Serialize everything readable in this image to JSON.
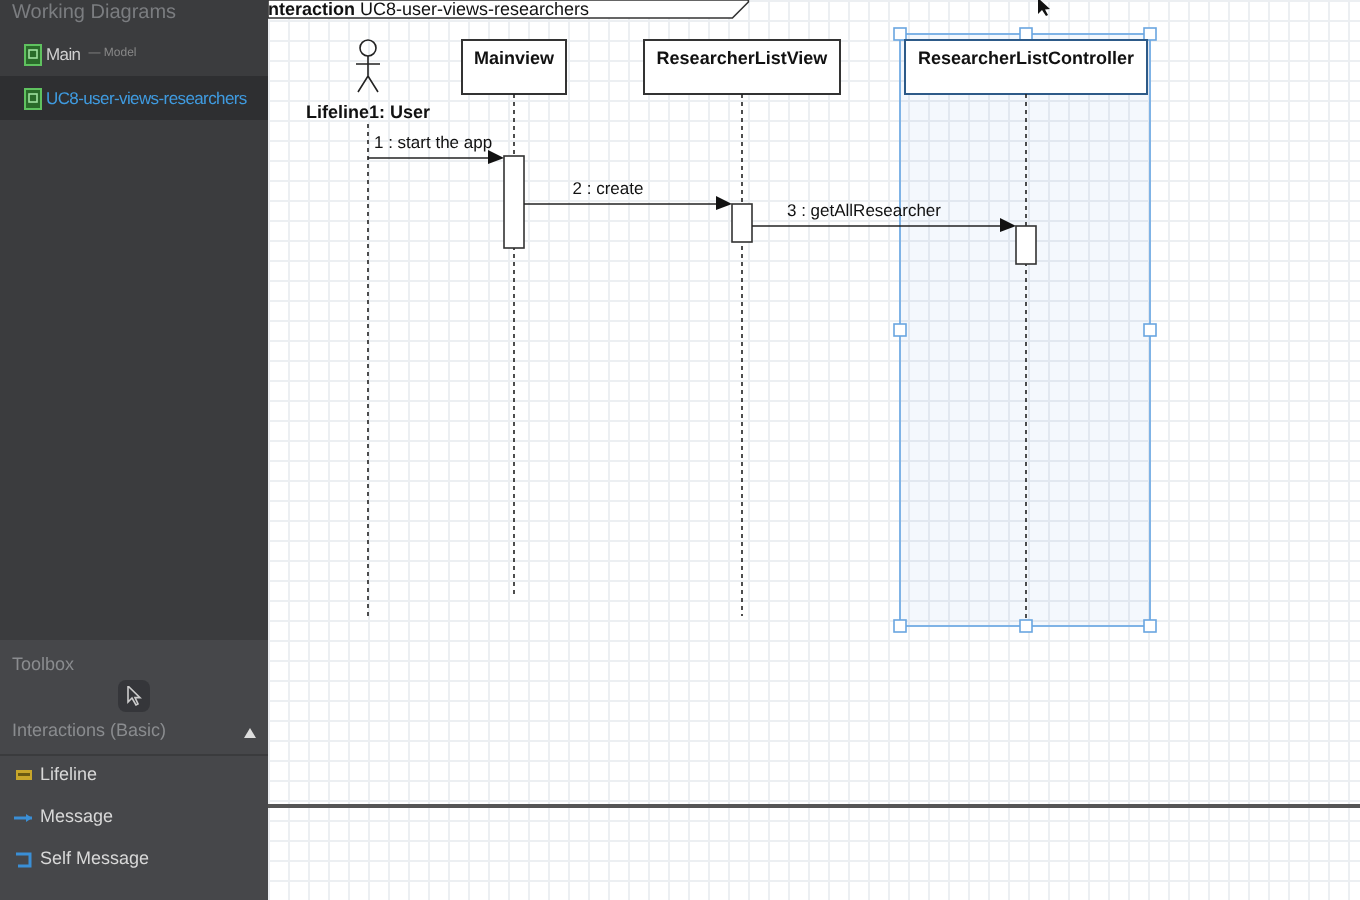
{
  "sidebar": {
    "title": "Working Diagrams",
    "items": [
      {
        "name": "Main",
        "suffix": "— Model",
        "selected": false
      },
      {
        "name": "UC8-user-views-researchers",
        "selected": true
      }
    ]
  },
  "toolbox": {
    "title": "Toolbox",
    "section": {
      "title": "Interactions (Basic)",
      "expanded": true
    },
    "items": [
      {
        "label": "Lifeline",
        "kind": "lifeline"
      },
      {
        "label": "Message",
        "kind": "message"
      },
      {
        "label": "Self Message",
        "kind": "self"
      }
    ]
  },
  "diagram": {
    "frame": {
      "keyword": "nteraction",
      "name": "UC8-user-views-researchers"
    },
    "lifelines": [
      {
        "label": "Lifeline1: User",
        "kind": "actor",
        "selected": false
      },
      {
        "label": "Mainview",
        "kind": "object",
        "selected": false
      },
      {
        "label": "ResearcherListView",
        "kind": "object",
        "selected": false
      },
      {
        "label": "ResearcherListController",
        "kind": "object",
        "selected": true
      }
    ],
    "messages": [
      {
        "label": "1 : start the app"
      },
      {
        "label": "2 : create"
      },
      {
        "label": "3 : getAllResearcher"
      }
    ]
  }
}
